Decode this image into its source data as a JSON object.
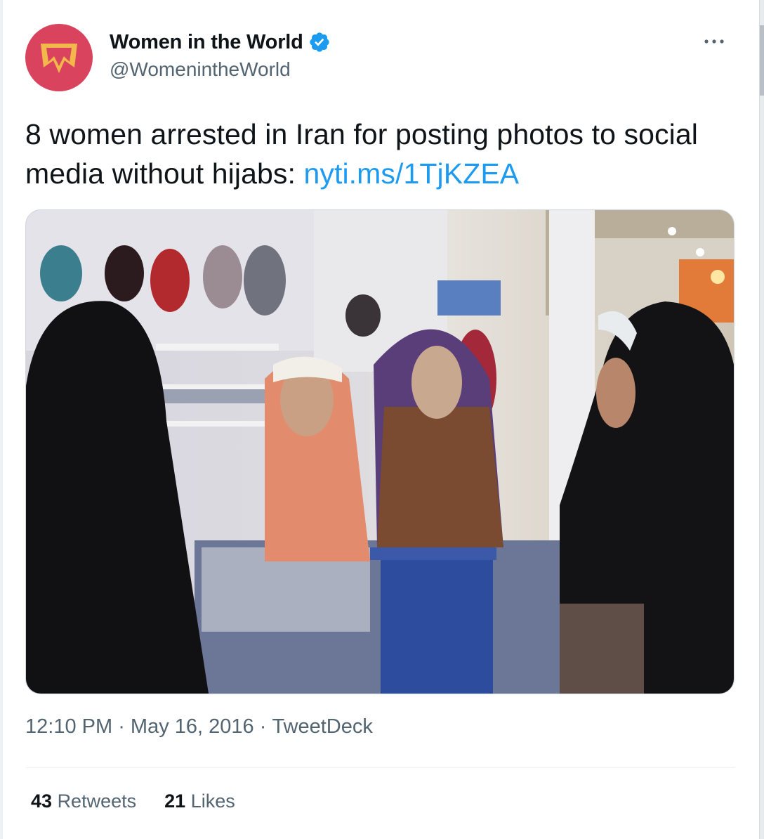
{
  "account": {
    "display_name": "Women in the World",
    "handle": "@WomenintheWorld",
    "verified": true,
    "avatar_color": "#d9435d",
    "avatar_logo_color": "#f3b84b"
  },
  "tweet": {
    "text": "8 women arrested in Iran for posting photos to social media without hijabs: ",
    "link": "nyti.ms/1TjKZEA",
    "link_color": "#1d9bf0",
    "media_alt": "photo"
  },
  "meta": {
    "time": "12:10 PM",
    "separator": " · ",
    "date": "May 16, 2016",
    "source": "TweetDeck"
  },
  "stats": {
    "retweets_count": "43",
    "retweets_label": "Retweets",
    "likes_count": "21",
    "likes_label": "Likes"
  },
  "icons": {
    "verified": "verified-badge-icon",
    "more": "more-options-icon"
  }
}
